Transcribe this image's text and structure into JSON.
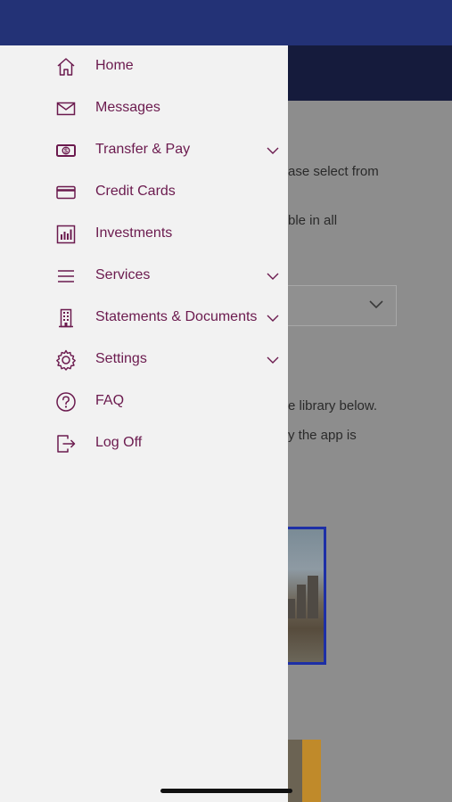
{
  "colors": {
    "status_bar": "#233276",
    "header_bg": "#151b3c",
    "drawer_bg": "#f2f2f2",
    "menu_text": "#6b1a4e",
    "image_border": "#1d2fa6"
  },
  "background": {
    "text_lines": [
      "ase select from",
      "ble in all",
      "e library below.",
      "y the app is"
    ],
    "dropdown_icon": "chevron-down-icon"
  },
  "menu": {
    "items": [
      {
        "label": "Home",
        "icon": "home-icon",
        "has_submenu": false
      },
      {
        "label": "Messages",
        "icon": "envelope-icon",
        "has_submenu": false
      },
      {
        "label": "Transfer & Pay",
        "icon": "dollar-bill-icon",
        "has_submenu": true
      },
      {
        "label": "Credit Cards",
        "icon": "credit-card-icon",
        "has_submenu": false
      },
      {
        "label": "Investments",
        "icon": "bar-chart-icon",
        "has_submenu": false
      },
      {
        "label": "Services",
        "icon": "hamburger-icon",
        "has_submenu": true
      },
      {
        "label": "Statements & Documents",
        "icon": "building-icon",
        "has_submenu": true
      },
      {
        "label": "Settings",
        "icon": "gear-icon",
        "has_submenu": true
      },
      {
        "label": "FAQ",
        "icon": "question-circle-icon",
        "has_submenu": false
      },
      {
        "label": "Log Off",
        "icon": "logout-icon",
        "has_submenu": false
      }
    ]
  }
}
